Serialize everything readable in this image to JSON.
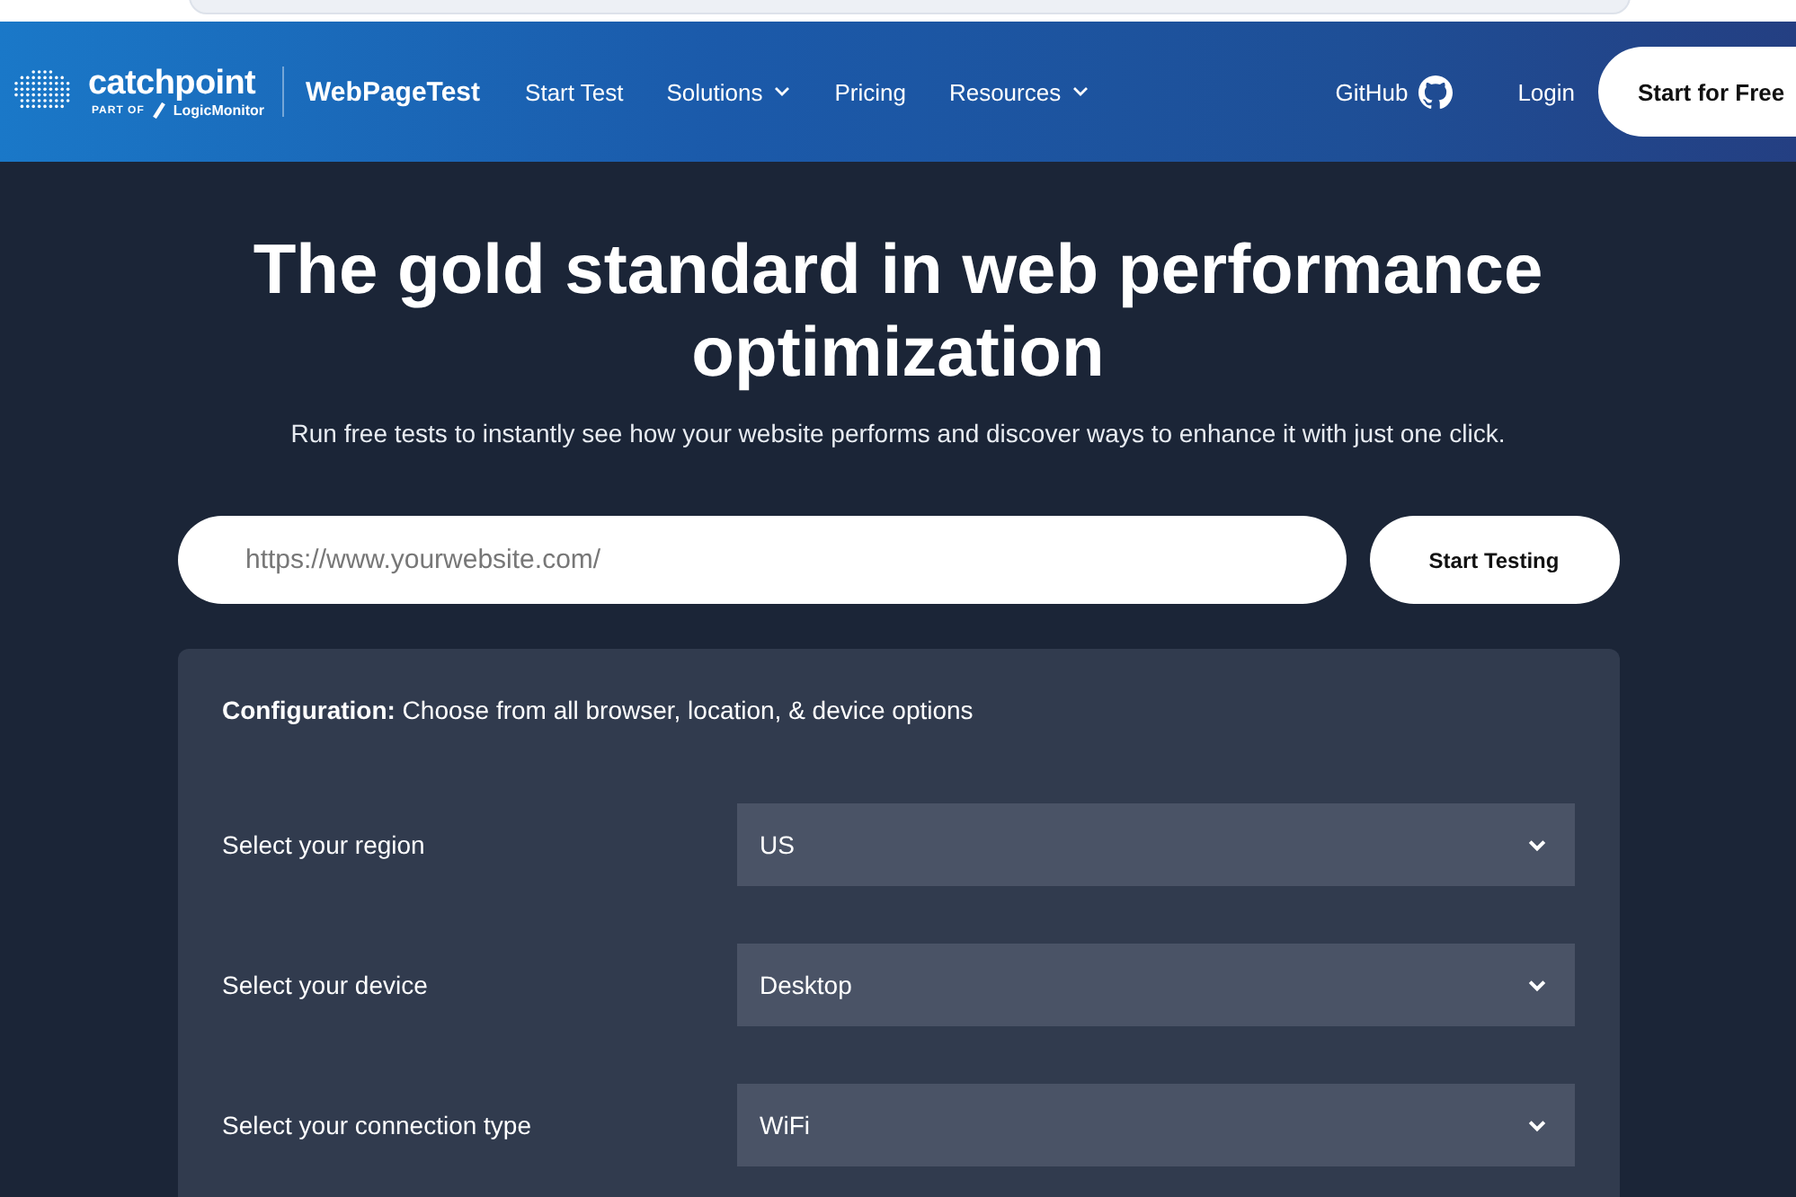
{
  "header": {
    "logo": {
      "name": "catchpoint",
      "tagline_prefix": "PART OF",
      "tagline_brand": "LogicMonitor"
    },
    "product": "WebPageTest",
    "nav": [
      {
        "label": "Start Test",
        "dropdown": false
      },
      {
        "label": "Solutions",
        "dropdown": true
      },
      {
        "label": "Pricing",
        "dropdown": false
      },
      {
        "label": "Resources",
        "dropdown": true
      }
    ],
    "github": "GitHub",
    "login": "Login",
    "cta": "Start for Free"
  },
  "hero": {
    "title": "The gold standard in web performance optimization",
    "subtitle": "Run free tests to instantly see how your website performs and discover ways to enhance it with just one click."
  },
  "url_field": {
    "placeholder": "https://www.yourwebsite.com/"
  },
  "start_button": "Start Testing",
  "configuration": {
    "intro": "**Configuration:** Choose from all browser, location, & device options",
    "rows": [
      {
        "label": "Select your region",
        "value": "US"
      },
      {
        "label": "Select your device",
        "value": "Desktop"
      },
      {
        "label": "Select your connection type",
        "value": "WiFi"
      }
    ]
  }
}
